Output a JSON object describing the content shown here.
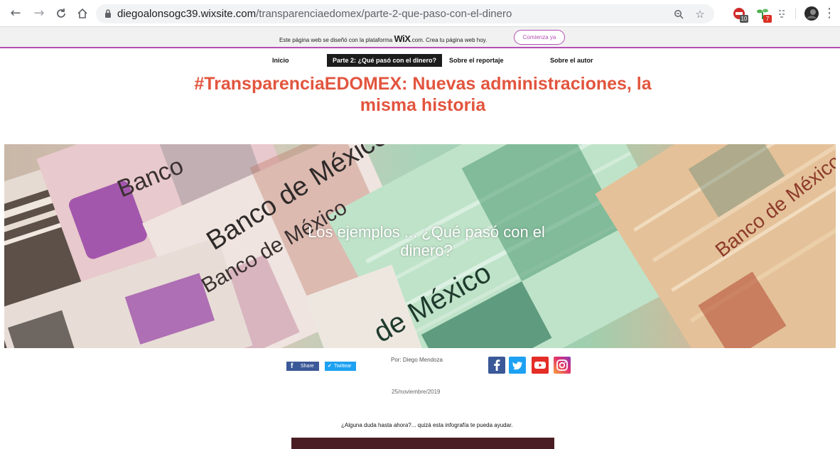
{
  "browser": {
    "url_host": "diegoalonsogc39.wixsite.com",
    "url_path": "/transparenciaedomex/parte-2-que-paso-con-el-dinero",
    "extension_badges": [
      "10",
      "7"
    ]
  },
  "wix_banner": {
    "text_before": "Este página web se diseñó con la plataforma ",
    "logo": "WiX",
    "text_after": ".com. Crea tu página web hoy.",
    "button": "Comienza ya"
  },
  "nav": {
    "items": [
      "Inicio",
      "Parte 2: ¿Qué pasó con el dinero?",
      "Sobre el reportaje",
      "Sobre el autor"
    ]
  },
  "article": {
    "title": "#TransparenciaEDOMEX: Nuevas administraciones, la misma historia",
    "hero_text": "Los ejemplos ... ¿Qué pasó con el dinero?",
    "hero_words": [
      "Banco",
      "Banco de México",
      "Banco de México",
      "Banco de México",
      "Banco de México",
      "de México"
    ],
    "share_fb": "Share",
    "share_tw": "Twittear",
    "byline": "Por: Diego Mendoza",
    "date": "25/noviembre/2019",
    "question": "¿Alguna duda hasta ahora?... quizá esta infografía te pueda ayudar."
  },
  "colors": {
    "title": "#e2553e",
    "wix_accent": "#b44fb4",
    "facebook": "#3b5998",
    "twitter": "#1da1f2",
    "youtube": "#e52d27",
    "instagram": "#e1306c"
  },
  "icons": [
    "back-arrow-icon",
    "forward-arrow-icon",
    "reload-icon",
    "home-icon",
    "lock-icon",
    "zoom-icon",
    "star-icon",
    "extension-icons",
    "profile-avatar",
    "menu-dots-icon",
    "facebook-icon",
    "twitter-icon",
    "youtube-icon",
    "instagram-icon"
  ]
}
